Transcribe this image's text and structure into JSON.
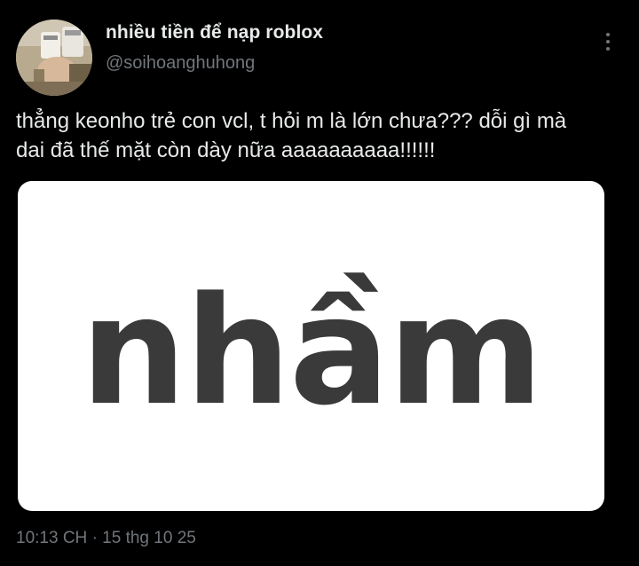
{
  "author": {
    "display_name": "nhiều tiền để nạp roblox",
    "handle": "@soihoanghuhong",
    "avatar_icon": "profile-photo"
  },
  "menu": {
    "icon": "more-vertical-icon"
  },
  "tweet": {
    "text_lines": [
      "thẳng keonho trẻ con vcl, t hỏi m là lớn chưa??? dỗi gì mà",
      "dai đã thế mặt còn dày nữa aaaaaaaaaa!!!!!!"
    ],
    "media_text": "nhầm",
    "time": "10:13 CH",
    "separator": "·",
    "date": "15 thg 10 25"
  },
  "colors": {
    "background": "#000000",
    "primary_text": "#e7e9ea",
    "secondary_text": "#71767b",
    "media_background": "#ffffff",
    "media_text": "#3a3a3a"
  }
}
